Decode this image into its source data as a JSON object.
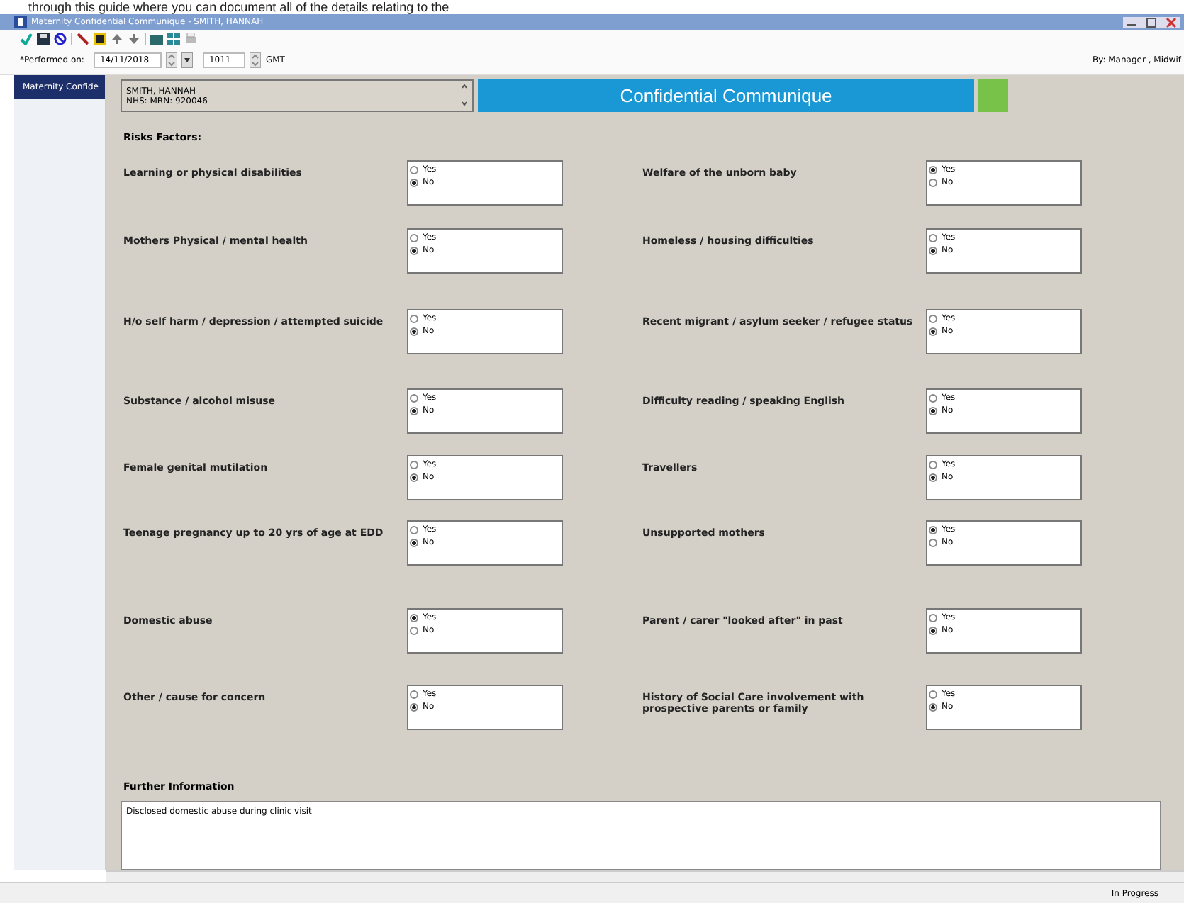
{
  "caption": "through this guide where you can document all of the details relating to the",
  "window": {
    "title": "Maternity Confidential Communique - SMITH, HANNAH"
  },
  "performed": {
    "label": "*Performed on:",
    "date": "14/11/2018",
    "time": "1011",
    "timezone": "GMT",
    "by": "By: Manager , Midwif"
  },
  "sidebar": {
    "items": [
      {
        "label": "Maternity Confide",
        "selected": true
      }
    ]
  },
  "patient": {
    "name": "SMITH, HANNAH",
    "ids": "NHS:  MRN: 920046"
  },
  "banner": {
    "title": "Confidential Communique"
  },
  "section_title": "Risks Factors:",
  "risk_factors": [
    {
      "label": "Learning or physical disabilities",
      "options": [
        {
          "label": "Yes",
          "selected": false
        },
        {
          "label": "No",
          "selected": true
        }
      ]
    },
    {
      "label": "Welfare of the unborn baby",
      "options": [
        {
          "label": "Yes",
          "selected": true
        },
        {
          "label": "No",
          "selected": false
        }
      ]
    },
    {
      "label": "Mothers Physical / mental health",
      "options": [
        {
          "label": "Yes",
          "selected": false
        },
        {
          "label": "No",
          "selected": true
        }
      ]
    },
    {
      "label": "Homeless / housing difficulties",
      "options": [
        {
          "label": "Yes",
          "selected": false
        },
        {
          "label": "No",
          "selected": true
        }
      ]
    },
    {
      "label": "H/o self harm / depression / attempted suicide",
      "options": [
        {
          "label": "Yes",
          "selected": false
        },
        {
          "label": "No",
          "selected": true
        }
      ]
    },
    {
      "label": "Recent migrant / asylum seeker / refugee status",
      "options": [
        {
          "label": "Yes",
          "selected": false
        },
        {
          "label": "No",
          "selected": true
        }
      ]
    },
    {
      "label": "Substance / alcohol misuse",
      "options": [
        {
          "label": "Yes",
          "selected": false
        },
        {
          "label": "No",
          "selected": true
        }
      ]
    },
    {
      "label": "Difficulty reading / speaking English",
      "options": [
        {
          "label": "Yes",
          "selected": false
        },
        {
          "label": "No",
          "selected": true
        }
      ]
    },
    {
      "label": "Female genital mutilation",
      "options": [
        {
          "label": "Yes",
          "selected": false
        },
        {
          "label": "No",
          "selected": true
        }
      ]
    },
    {
      "label": "Travellers",
      "options": [
        {
          "label": "Yes",
          "selected": false
        },
        {
          "label": "No",
          "selected": true
        }
      ]
    },
    {
      "label": "Teenage pregnancy up to 20 yrs of age at EDD",
      "options": [
        {
          "label": "Yes",
          "selected": false
        },
        {
          "label": "No",
          "selected": true
        }
      ]
    },
    {
      "label": "Unsupported mothers",
      "options": [
        {
          "label": "Yes",
          "selected": true
        },
        {
          "label": "No",
          "selected": false
        }
      ]
    },
    {
      "label": "Domestic abuse",
      "options": [
        {
          "label": "Yes",
          "selected": true
        },
        {
          "label": "No",
          "selected": false
        }
      ]
    },
    {
      "label": "Parent / carer \"looked after\" in past",
      "options": [
        {
          "label": "Yes",
          "selected": false
        },
        {
          "label": "No",
          "selected": true
        }
      ]
    },
    {
      "label": "Other / cause for concern",
      "options": [
        {
          "label": "Yes",
          "selected": false
        },
        {
          "label": "No",
          "selected": true
        }
      ]
    },
    {
      "label": "History of Social Care involvement with prospective parents or family",
      "options": [
        {
          "label": "Yes",
          "selected": false
        },
        {
          "label": "No",
          "selected": true
        }
      ]
    }
  ],
  "further_information": {
    "label": "Further Information",
    "value": "Disclosed domestic abuse during clinic visit"
  },
  "status_bar": {
    "status": "In Progress"
  }
}
